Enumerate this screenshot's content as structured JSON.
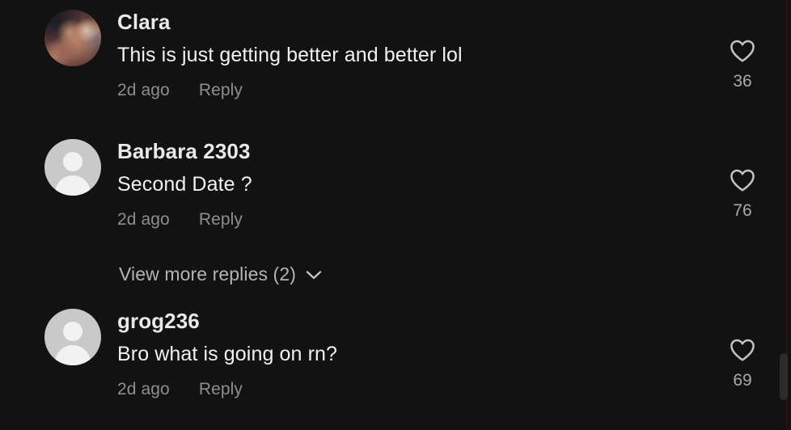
{
  "app": {
    "screen_name": "comments-section",
    "background_color": "#121212",
    "text_color": "#f1f1f1",
    "muted_text_color": "#8e8e8e"
  },
  "comments": [
    {
      "username": "Clara",
      "text": "This is just getting better and better lol",
      "time": "2d ago",
      "reply_label": "Reply",
      "like_count": "36",
      "avatar_type": "photo",
      "like_icon": "heart-icon"
    },
    {
      "username": "Barbara 2303",
      "text": "Second Date ?",
      "time": "2d ago",
      "reply_label": "Reply",
      "like_count": "76",
      "avatar_type": "default",
      "like_icon": "heart-icon"
    },
    {
      "username": "grog236",
      "text": "Bro what is going on rn?",
      "time": "2d ago",
      "reply_label": "Reply",
      "like_count": "69",
      "avatar_type": "default",
      "like_icon": "heart-icon"
    }
  ],
  "view_more_replies": {
    "label": "View more replies (2)",
    "icon": "chevron-down-icon"
  },
  "scrollbar": {
    "name": "vertical-scrollbar"
  }
}
